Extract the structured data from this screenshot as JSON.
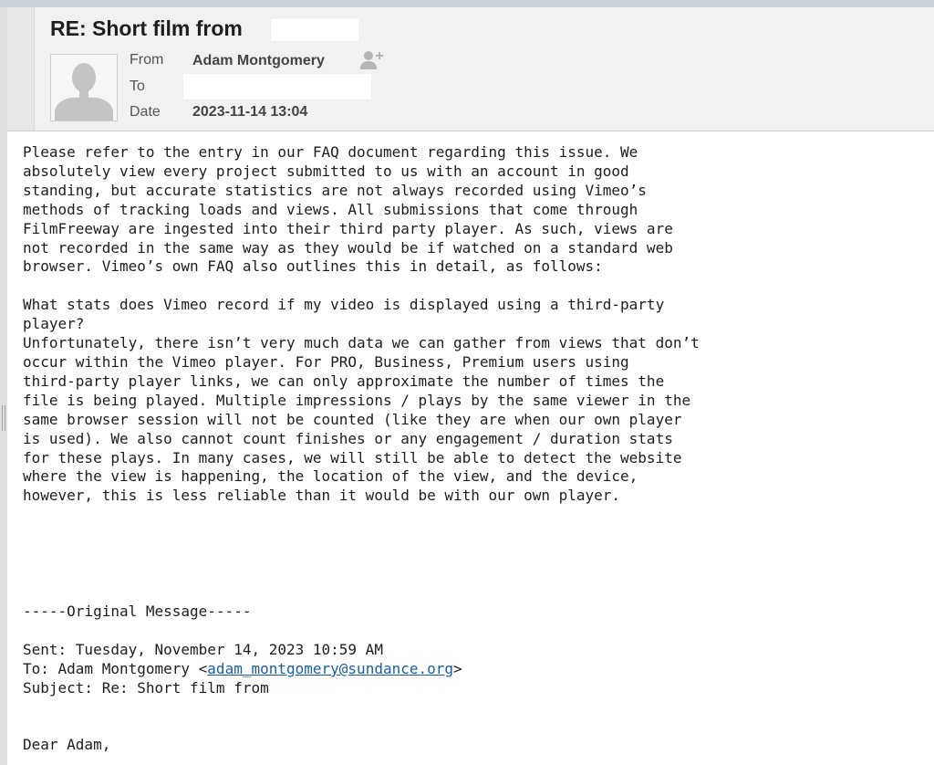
{
  "header": {
    "subject": "RE: Short film from",
    "from_label": "From",
    "from_value": "Adam Montgomery",
    "to_label": "To",
    "date_label": "Date",
    "date_value": "2023-11-14 13:04"
  },
  "body": {
    "paragraphs": [
      "Please refer to the entry in our FAQ document regarding this issue. We\nabsolutely view every project submitted to us with an account in good\nstanding, but accurate statistics are not always recorded using Vimeo’s\nmethods of tracking loads and views. All submissions that come through\nFilmFreeway are ingested into their third party player. As such, views are\nnot recorded in the same way as they would be if watched on a standard web\nbrowser. Vimeo’s own FAQ also outlines this in detail, as follows:",
      "What stats does Vimeo record if my video is displayed using a third-party\nplayer?\nUnfortunately, there isn’t very much data we can gather from views that don’t\noccur within the Vimeo player. For PRO, Business, Premium users using\nthird-party player links, we can only approximate the number of times the\nfile is being played. Multiple impressions / plays by the same viewer in the\nsame browser session will not be counted (like they are when our own player\nis used). We also cannot count finishes or any engagement / duration stats\nfor these plays. In many cases, we will still be able to detect the website\nwhere the view is happening, the location of the view, and the device,\nhowever, this is less reliable than it would be with our own player."
    ]
  },
  "original": {
    "divider": "-----Original Message-----",
    "sent": "Sent: Tuesday, November 14, 2023 10:59 AM",
    "to_prefix": "To: Adam Montgomery <",
    "to_email": "adam_montgomery@sundance.org",
    "to_suffix": ">",
    "subject": "Subject: Re: Short film from",
    "greeting": "Dear Adam,"
  },
  "icons": {
    "avatar": "person-placeholder-icon",
    "add_contact": "add-contact-icon"
  },
  "colors": {
    "link": "#1a5fa8",
    "header_bg": "#f1f1f1"
  }
}
